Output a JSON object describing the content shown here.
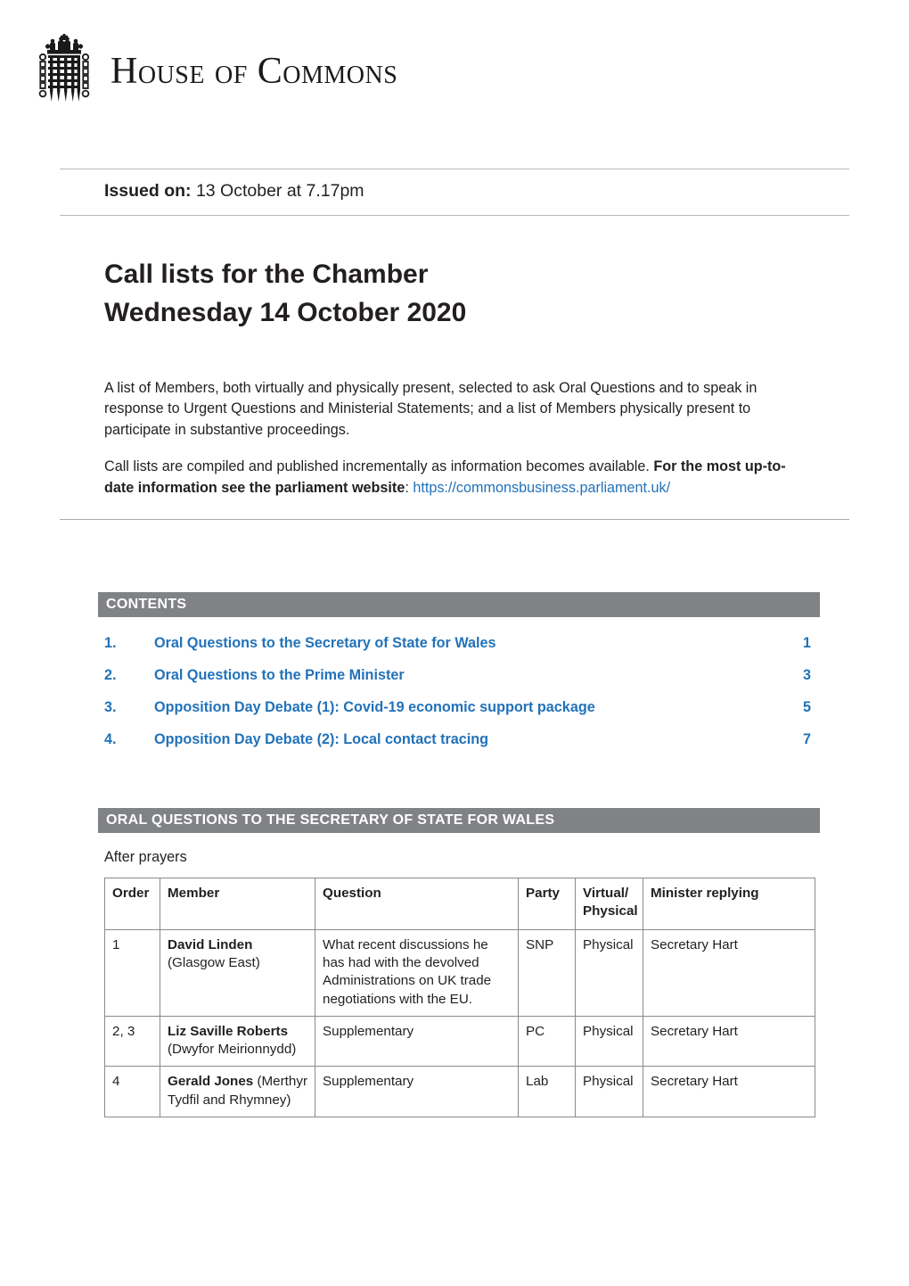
{
  "masthead": {
    "logo_icon": "portcullis-crown-icon",
    "wordmark_part1": "H",
    "wordmark_part2": "OUSE",
    "wordmark_of": "OF",
    "wordmark_part3": "C",
    "wordmark_part4": "OMMONS",
    "wordmark_full": "HOUSE OF COMMONS"
  },
  "issued": {
    "label": "Issued on:",
    "value": "13 October at 7.17pm"
  },
  "title": {
    "line1": "Call lists for the Chamber",
    "line2": "Wednesday 14 October 2020"
  },
  "intro": {
    "paragraph1": "A list of Members, both virtually and physically present, selected to ask Oral Questions and to speak in response to Urgent Questions and Ministerial Statements; and a list of Members physically present to participate in substantive proceedings.",
    "paragraph2_plain": "Call lists are compiled and published incrementally as information becomes available. ",
    "paragraph2_bold": "For the most up-to-date information see the parliament website",
    "paragraph2_colon": ": ",
    "paragraph2_link": "https://commonsbusiness.parliament.uk/"
  },
  "contents": {
    "heading": "CONTENTS",
    "items": [
      {
        "num": "1.",
        "label": "Oral Questions to the Secretary of State for Wales",
        "page": "1"
      },
      {
        "num": "2.",
        "label": "Oral Questions to the Prime Minister",
        "page": "3"
      },
      {
        "num": "3.",
        "label": "Opposition Day Debate (1): Covid-19 economic support package",
        "page": "5"
      },
      {
        "num": "4.",
        "label": "Opposition Day Debate (2): Local contact tracing",
        "page": "7"
      }
    ]
  },
  "section": {
    "heading": "ORAL QUESTIONS TO THE SECRETARY OF STATE FOR WALES",
    "note": "After prayers"
  },
  "table": {
    "columns": [
      "Order",
      "Member",
      "Question",
      "Party",
      "Virtual/ Physical",
      "Minister replying"
    ],
    "col_order": "Order",
    "col_member": "Member",
    "col_question": "Question",
    "col_party": "Party",
    "col_vp_line1": "Virtual/",
    "col_vp_line2": "Physical",
    "col_minister": "Minister replying",
    "rows": [
      {
        "order": "1",
        "member_name": "David Linden",
        "member_constituency": "(Glasgow East)",
        "member_layout": "block",
        "question": "What recent discussions he has had with the devolved Administrations on UK trade negotiations with the EU.",
        "party": "SNP",
        "virtual_physical": "Physical",
        "minister": "Secretary Hart"
      },
      {
        "order": "2, 3",
        "member_name": "Liz Saville Roberts",
        "member_constituency": "(Dwyfor Meirionnydd)",
        "member_layout": "block",
        "question": "Supplementary",
        "party": "PC",
        "virtual_physical": "Physical",
        "minister": "Secretary Hart"
      },
      {
        "order": "4",
        "member_name": "Gerald Jones",
        "member_constituency": "(Merthyr Tydfil and Rhymney)",
        "member_layout": "inline",
        "question": "Supplementary",
        "party": "Lab",
        "virtual_physical": "Physical",
        "minister": "Secretary Hart"
      }
    ]
  },
  "colors": {
    "bar_grey": "#808285",
    "link_blue": "#2272b9",
    "text": "#231f20",
    "rule": "#b8b8b8",
    "table_border": "#8a8a8a"
  }
}
